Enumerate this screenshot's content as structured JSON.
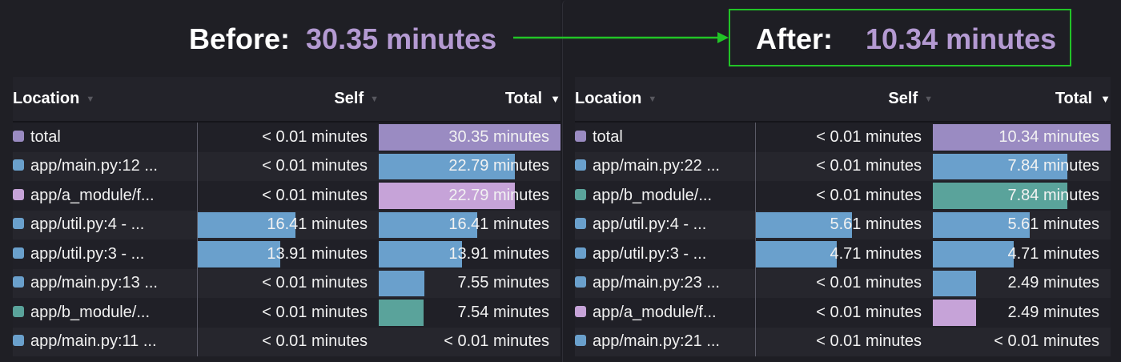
{
  "before": {
    "label": "Before:",
    "value": "30.35 minutes",
    "columns": {
      "location": "Location",
      "self": "Self",
      "total": "Total"
    },
    "rows": [
      {
        "location": "total",
        "color": "#9a8bc2",
        "self": "< 0.01 minutes",
        "self_fraction": 0,
        "total": "30.35 minutes",
        "total_fraction": 1.0
      },
      {
        "location": "app/main.py:12 ...",
        "color": "#6aa0cc",
        "self": "< 0.01 minutes",
        "self_fraction": 0,
        "total": "22.79 minutes",
        "total_fraction": 0.751
      },
      {
        "location": "app/a_module/f...",
        "color": "#c6a3d8",
        "self": "< 0.01 minutes",
        "self_fraction": 0,
        "total": "22.79 minutes",
        "total_fraction": 0.751
      },
      {
        "location": "app/util.py:4 - ...",
        "color": "#6aa0cc",
        "self": "16.41 minutes",
        "self_fraction": 0.541,
        "total": "16.41 minutes",
        "total_fraction": 0.541
      },
      {
        "location": "app/util.py:3 - ...",
        "color": "#6aa0cc",
        "self": "13.91 minutes",
        "self_fraction": 0.458,
        "total": "13.91 minutes",
        "total_fraction": 0.458
      },
      {
        "location": "app/main.py:13 ...",
        "color": "#6aa0cc",
        "self": "< 0.01 minutes",
        "self_fraction": 0,
        "total": "7.55 minutes",
        "total_fraction": 0.249
      },
      {
        "location": "app/b_module/...",
        "color": "#5aa39b",
        "self": "< 0.01 minutes",
        "self_fraction": 0,
        "total": "7.54 minutes",
        "total_fraction": 0.248
      },
      {
        "location": "app/main.py:11 ...",
        "color": "#6aa0cc",
        "self": "< 0.01 minutes",
        "self_fraction": 0,
        "total": "< 0.01 minutes",
        "total_fraction": 0
      }
    ]
  },
  "after": {
    "label": "After:",
    "value": "10.34 minutes",
    "columns": {
      "location": "Location",
      "self": "Self",
      "total": "Total"
    },
    "rows": [
      {
        "location": "total",
        "color": "#9a8bc2",
        "self": "< 0.01 minutes",
        "self_fraction": 0,
        "total": "10.34 minutes",
        "total_fraction": 1.0
      },
      {
        "location": "app/main.py:22 ...",
        "color": "#6aa0cc",
        "self": "< 0.01 minutes",
        "self_fraction": 0,
        "total": "7.84 minutes",
        "total_fraction": 0.758
      },
      {
        "location": "app/b_module/...",
        "color": "#5aa39b",
        "self": "< 0.01 minutes",
        "self_fraction": 0,
        "total": "7.84 minutes",
        "total_fraction": 0.758
      },
      {
        "location": "app/util.py:4 - ...",
        "color": "#6aa0cc",
        "self": "5.61 minutes",
        "self_fraction": 0.543,
        "total": "5.61 minutes",
        "total_fraction": 0.543
      },
      {
        "location": "app/util.py:3 - ...",
        "color": "#6aa0cc",
        "self": "4.71 minutes",
        "self_fraction": 0.456,
        "total": "4.71 minutes",
        "total_fraction": 0.456
      },
      {
        "location": "app/main.py:23 ...",
        "color": "#6aa0cc",
        "self": "< 0.01 minutes",
        "self_fraction": 0,
        "total": "2.49 minutes",
        "total_fraction": 0.241
      },
      {
        "location": "app/a_module/f...",
        "color": "#c6a3d8",
        "self": "< 0.01 minutes",
        "self_fraction": 0,
        "total": "2.49 minutes",
        "total_fraction": 0.241
      },
      {
        "location": "app/main.py:21 ...",
        "color": "#6aa0cc",
        "self": "< 0.01 minutes",
        "self_fraction": 0,
        "total": "< 0.01 minutes",
        "total_fraction": 0
      }
    ]
  },
  "colors": {
    "accent_value": "#b49ad2",
    "highlight_box": "#22c427",
    "arrow": "#22c427"
  }
}
